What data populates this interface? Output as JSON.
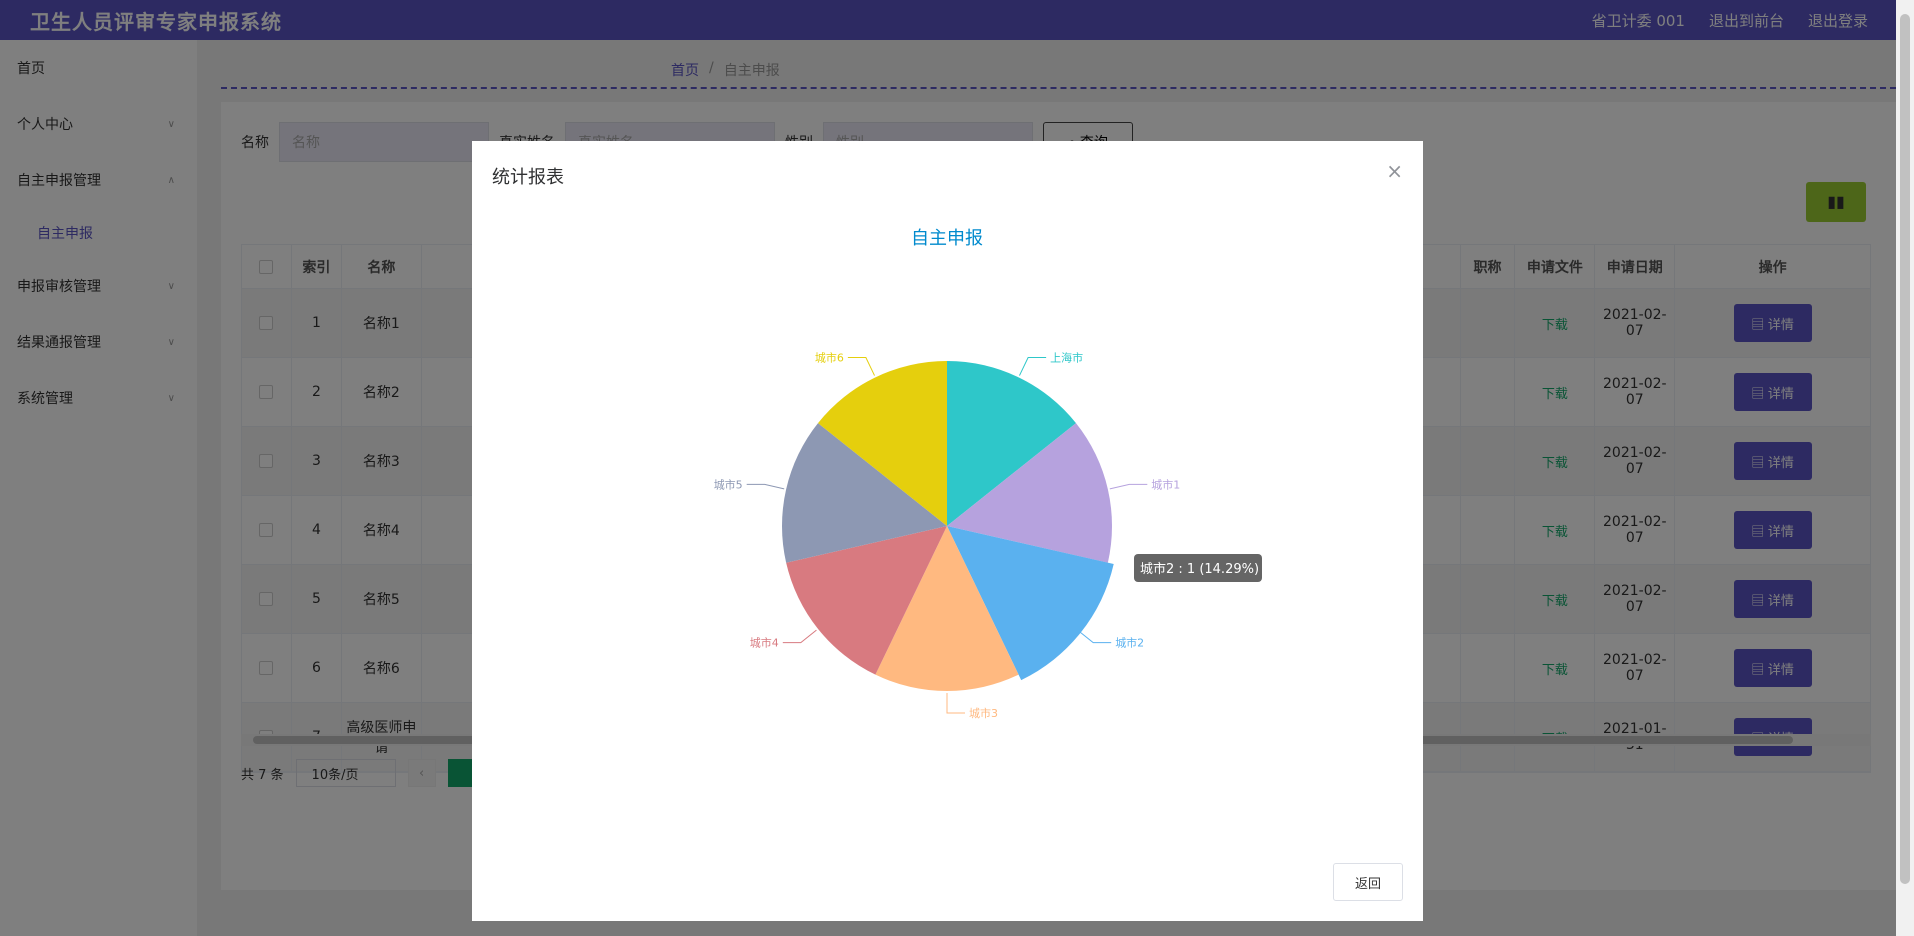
{
  "header": {
    "title": "卫生人员评审专家申报系统",
    "user": "省卫计委 001",
    "front": "退出到前台",
    "logout": "退出登录"
  },
  "sidebar": {
    "items": [
      {
        "label": "首页"
      },
      {
        "label": "个人中心"
      },
      {
        "label": "自主申报管理"
      },
      {
        "label": "申报审核管理"
      },
      {
        "label": "结果通报管理"
      },
      {
        "label": "系统管理"
      }
    ],
    "sub_item": "自主申报"
  },
  "breadcrumb": {
    "home": "首页",
    "sep": "/",
    "current": "自主申报"
  },
  "search": {
    "name_label": "名称",
    "name_placeholder": "名称",
    "real_label": "真实姓名",
    "real_placeholder": "真实姓名",
    "gender_label": "性别",
    "gender_placeholder": "性别",
    "query": "查询"
  },
  "table": {
    "headers": {
      "index": "索引",
      "name": "名称",
      "title": "职称",
      "file": "申请文件",
      "date": "申请日期",
      "op": "操作"
    },
    "download": "下载",
    "detail": "详情",
    "rows": [
      {
        "index": "1",
        "name": "名称1",
        "date": "2021-02-07"
      },
      {
        "index": "2",
        "name": "名称2",
        "date": "2021-02-07"
      },
      {
        "index": "3",
        "name": "名称3",
        "date": "2021-02-07"
      },
      {
        "index": "4",
        "name": "名称4",
        "date": "2021-02-07"
      },
      {
        "index": "5",
        "name": "名称5",
        "date": "2021-02-07"
      },
      {
        "index": "6",
        "name": "名称6",
        "date": "2021-02-07"
      },
      {
        "index": "7",
        "name": "高级医师申请",
        "date": "2021-01-31"
      }
    ]
  },
  "pager": {
    "total": "共 7 条",
    "size": "10条/页"
  },
  "dialog": {
    "title": "统计报表",
    "return": "返回"
  },
  "chart_data": {
    "type": "pie",
    "title": "自主申报",
    "categories": [
      "上海市",
      "城市1",
      "城市2",
      "城市3",
      "城市4",
      "城市5",
      "城市6"
    ],
    "values": [
      1,
      1,
      1,
      1,
      1,
      1,
      1
    ],
    "colors": [
      "#2ec7c9",
      "#b6a2de",
      "#5ab1ef",
      "#ffb980",
      "#d87a80",
      "#8d98b3",
      "#e5cf0d"
    ],
    "tooltip": "城市2 : 1 (14.29%)",
    "highlighted": "城市2"
  }
}
